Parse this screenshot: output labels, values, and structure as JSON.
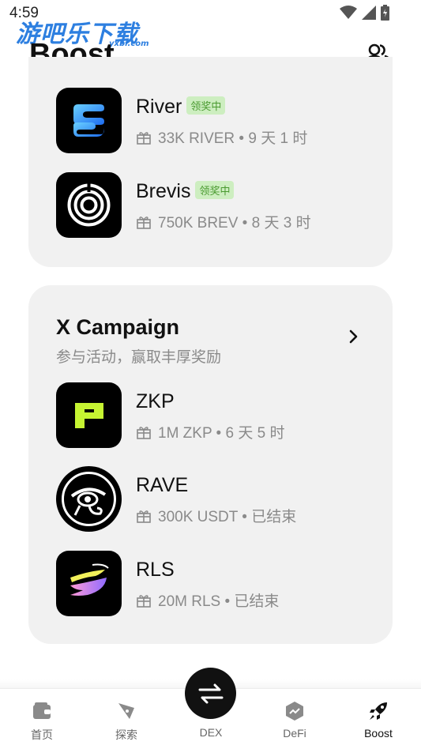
{
  "status_bar": {
    "time": "4:59"
  },
  "watermark": {
    "text": "游吧乐下载",
    "sub": "yxbl.com"
  },
  "page": {
    "title": "Boost"
  },
  "top_card": {
    "items": [
      {
        "name": "River",
        "badge": "领奖中",
        "sub": "33K RIVER • 9 天 1 时",
        "logo_icon": "river-logo-icon"
      },
      {
        "name": "Brevis",
        "badge": "领奖中",
        "sub": "750K BREV • 8 天 3 时",
        "logo_icon": "brevis-logo-icon"
      }
    ]
  },
  "x_campaign": {
    "title": "X Campaign",
    "subtitle": "参与活动，赢取丰厚奖励",
    "items": [
      {
        "name": "ZKP",
        "sub": "1M ZKP • 6 天 5 时",
        "logo_icon": "zkp-logo-icon"
      },
      {
        "name": "RAVE",
        "sub": "300K USDT • 已结束",
        "logo_icon": "rave-logo-icon"
      },
      {
        "name": "RLS",
        "sub": "20M RLS • 已结束",
        "logo_icon": "rls-logo-icon"
      }
    ]
  },
  "bottom_nav": {
    "items": [
      {
        "label": "首页",
        "icon": "wallet-icon"
      },
      {
        "label": "探索",
        "icon": "compass-icon"
      },
      {
        "label": "DEX",
        "icon": "swap-icon"
      },
      {
        "label": "DeFi",
        "icon": "defi-icon"
      },
      {
        "label": "Boost",
        "icon": "rocket-icon"
      }
    ],
    "active": "Boost"
  },
  "colors": {
    "badge_bg": "#cdeec0",
    "badge_text": "#4a9a30",
    "card_bg": "#f1f1f1",
    "zkp_accent": "#c6f432"
  }
}
